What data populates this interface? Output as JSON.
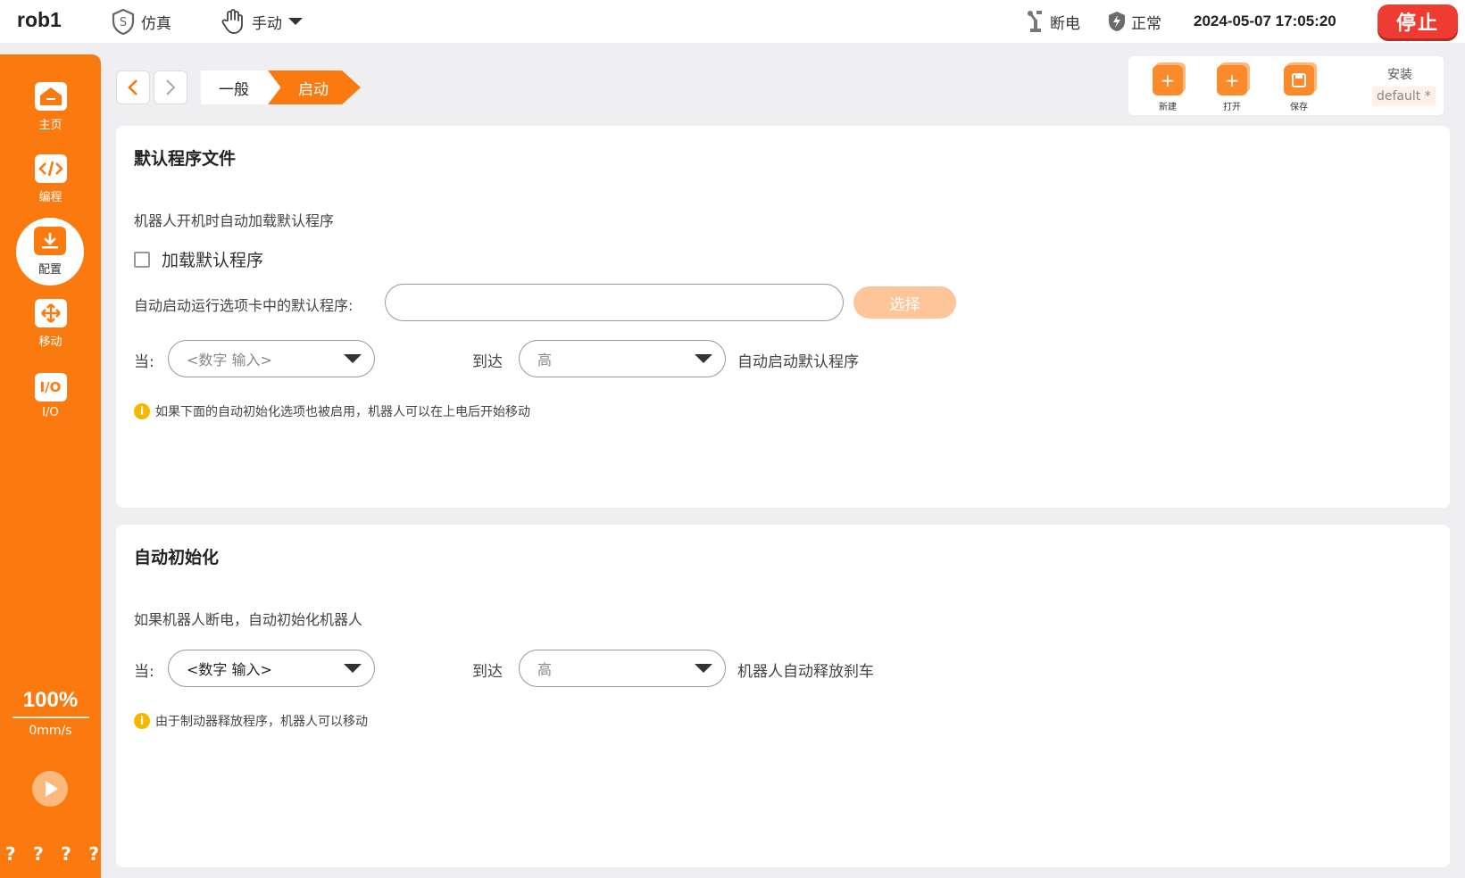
{
  "topbar": {
    "robot_name": "rob1",
    "sim_label": "仿真",
    "mode_label": "手动",
    "power_label": "断电",
    "status_label": "正常",
    "datetime": "2024-05-07 17:05:20",
    "stop_label": "停止"
  },
  "sidebar": {
    "items": [
      {
        "label": "主页",
        "icon": "home-icon"
      },
      {
        "label": "编程",
        "icon": "code-icon"
      },
      {
        "label": "配置",
        "icon": "config-icon"
      },
      {
        "label": "移动",
        "icon": "move-icon"
      },
      {
        "label": "I/O",
        "icon": "io-icon",
        "glyph": "I/O"
      }
    ],
    "speed_percent": "100%",
    "speed_value": "0mm/s",
    "help": [
      "?",
      "?",
      "?",
      "?"
    ]
  },
  "breadcrumb": {
    "items": [
      "一般",
      "启动"
    ]
  },
  "toolbar": {
    "new_label": "新建",
    "open_label": "打开",
    "save_label": "保存",
    "install_label": "安装",
    "install_value": "default *"
  },
  "card1": {
    "title": "默认程序文件",
    "desc": "机器人开机时自动加载默认程序",
    "checkbox_label": "加载默认程序",
    "file_label": "自动启动运行选项卡中的默认程序:",
    "file_value": "",
    "choose_label": "选择",
    "when_label": "当:",
    "when_value": "<数字 输入>",
    "reach_label": "到达",
    "reach_value": "高",
    "suffix": "自动启动默认程序",
    "note": "如果下面的自动初始化选项也被启用，机器人可以在上电后开始移动"
  },
  "card2": {
    "title": "自动初始化",
    "desc": "如果机器人断电，自动初始化机器人",
    "when_label": "当:",
    "when_value": "<数字 输入>",
    "reach_label": "到达",
    "reach_value": "高",
    "suffix": "机器人自动释放刹车",
    "note": "由于制动器释放程序，机器人可以移动"
  },
  "colors": {
    "accent": "#fb7a10",
    "stop": "#ee3c32",
    "info": "#f5b800"
  }
}
